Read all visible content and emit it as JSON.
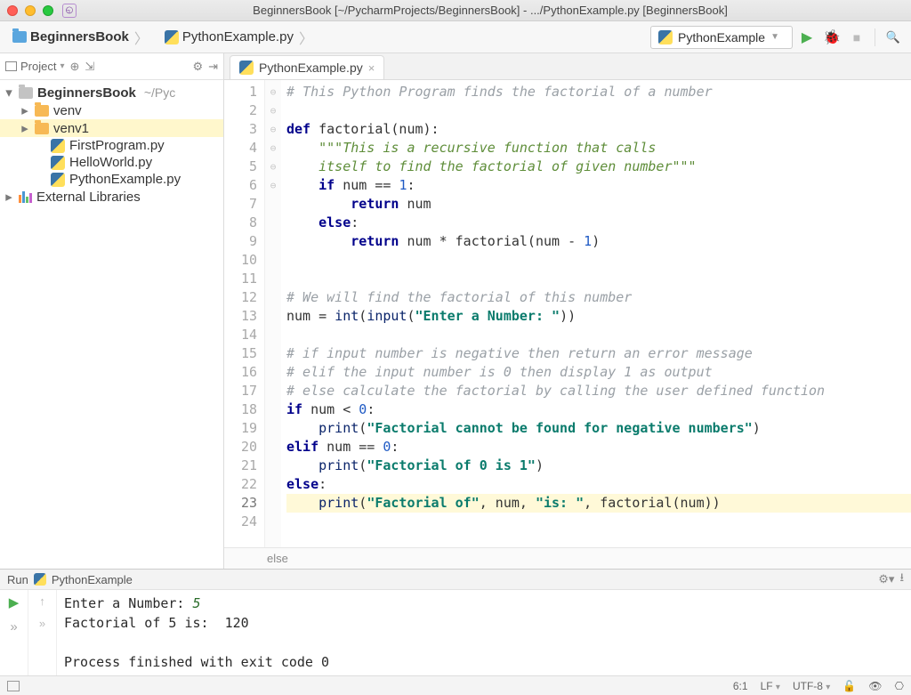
{
  "window": {
    "title": "BeginnersBook [~/PycharmProjects/BeginnersBook] - .../PythonExample.py [BeginnersBook]"
  },
  "breadcrumb": {
    "project": "BeginnersBook",
    "file": "PythonExample.py"
  },
  "run_config": {
    "label": "PythonExample"
  },
  "sidebar": {
    "toolbar_label": "Project",
    "items": [
      {
        "name": "BeginnersBook",
        "path": "~/Pyc",
        "kind": "project"
      },
      {
        "name": "venv",
        "kind": "venv"
      },
      {
        "name": "venv1",
        "kind": "venv",
        "selected": true
      },
      {
        "name": "FirstProgram.py",
        "kind": "py"
      },
      {
        "name": "HelloWorld.py",
        "kind": "py"
      },
      {
        "name": "PythonExample.py",
        "kind": "py"
      },
      {
        "name": "External Libraries",
        "kind": "lib"
      }
    ]
  },
  "editor": {
    "tab": "PythonExample.py",
    "crumb": "else",
    "lines": [
      {
        "n": 1,
        "html": "<span class='c-cmt'># This Python Program finds the factorial of a number</span>"
      },
      {
        "n": 2,
        "html": ""
      },
      {
        "n": 3,
        "html": "<span class='c-def'>def</span> <span class='c-fn'>factorial</span>(num):"
      },
      {
        "n": 4,
        "html": "    <span class='c-doc'>\"\"\"This is a recursive function that calls</span>"
      },
      {
        "n": 5,
        "html": "<span class='c-doc'>    itself to find the factorial of given number\"\"\"</span>"
      },
      {
        "n": 6,
        "html": "    <span class='c-kw'>if</span> num == <span class='c-num'>1</span>:"
      },
      {
        "n": 7,
        "html": "        <span class='c-kw'>return</span> num"
      },
      {
        "n": 8,
        "html": "    <span class='c-kw'>else</span>:"
      },
      {
        "n": 9,
        "html": "        <span class='c-kw'>return</span> num * factorial(num - <span class='c-num'>1</span>)"
      },
      {
        "n": 10,
        "html": ""
      },
      {
        "n": 11,
        "html": ""
      },
      {
        "n": 12,
        "html": "<span class='c-cmt'># We will find the factorial of this number</span>"
      },
      {
        "n": 13,
        "html": "num = <span class='c-bi'>int</span>(<span class='c-bi'>input</span>(<span class='c-str'>\"Enter a Number: \"</span>))"
      },
      {
        "n": 14,
        "html": ""
      },
      {
        "n": 15,
        "html": "<span class='c-cmt'># if input number is negative then return an error message</span>"
      },
      {
        "n": 16,
        "html": "<span class='c-cmt'># elif the input number is 0 then display 1 as output</span>"
      },
      {
        "n": 17,
        "html": "<span class='c-cmt'># else calculate the factorial by calling the user defined function</span>"
      },
      {
        "n": 18,
        "html": "<span class='c-kw'>if</span> num &lt; <span class='c-num'>0</span>:"
      },
      {
        "n": 19,
        "html": "    <span class='c-bi'>print</span>(<span class='c-str'>\"Factorial cannot be found for negative numbers\"</span>)"
      },
      {
        "n": 20,
        "html": "<span class='c-kw'>elif</span> num == <span class='c-num'>0</span>:"
      },
      {
        "n": 21,
        "html": "    <span class='c-bi'>print</span>(<span class='c-str'>\"Factorial of 0 is 1\"</span>)"
      },
      {
        "n": 22,
        "html": "<span class='c-kw'>else</span>:"
      },
      {
        "n": 23,
        "cur": true,
        "html": "    <span class='c-bi'>print</span>(<span class='c-str'>\"Factorial of\"</span>, num, <span class='c-str'>\"is: \"</span>, factorial(num))"
      },
      {
        "n": 24,
        "html": ""
      }
    ]
  },
  "run": {
    "title": "Run",
    "config": "PythonExample",
    "output": [
      "Enter a Number: 5",
      "Factorial of 5 is:  120",
      "",
      "Process finished with exit code 0"
    ]
  },
  "status": {
    "pos": "6:1",
    "line_sep": "LF",
    "encoding": "UTF-8"
  }
}
